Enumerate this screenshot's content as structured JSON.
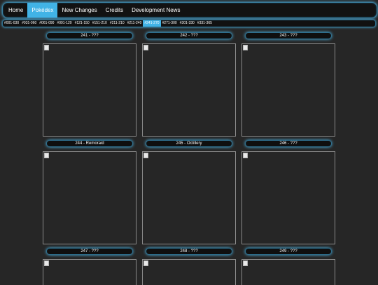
{
  "nav": {
    "items": [
      {
        "label": "Home"
      },
      {
        "label": "Pokédex"
      },
      {
        "label": "New Changes"
      },
      {
        "label": "Credits"
      },
      {
        "label": "Development News"
      }
    ],
    "active_index": 1
  },
  "ranges": {
    "items": [
      {
        "label": "#001-030"
      },
      {
        "label": "#031-060"
      },
      {
        "label": "#061-090"
      },
      {
        "label": "#091-120"
      },
      {
        "label": "#121-150"
      },
      {
        "label": "#151-210"
      },
      {
        "label": "#211-210"
      },
      {
        "label": "#211-240"
      },
      {
        "label": "#241-270"
      },
      {
        "label": "#271-300"
      },
      {
        "label": "#301-330"
      },
      {
        "label": "#331-365"
      }
    ],
    "active_index": 8
  },
  "entries": [
    {
      "label": "241 - ???"
    },
    {
      "label": "242 - ???"
    },
    {
      "label": "243 - ???"
    },
    {
      "label": "244 - Remoraid"
    },
    {
      "label": "245 - Octillery"
    },
    {
      "label": "246 - ???"
    },
    {
      "label": "247 - ???"
    },
    {
      "label": "248 - ???"
    },
    {
      "label": "249 - ???"
    }
  ],
  "colors": {
    "accent": "#41b3e6",
    "glow": "#4fb8e8",
    "background": "#262626"
  }
}
